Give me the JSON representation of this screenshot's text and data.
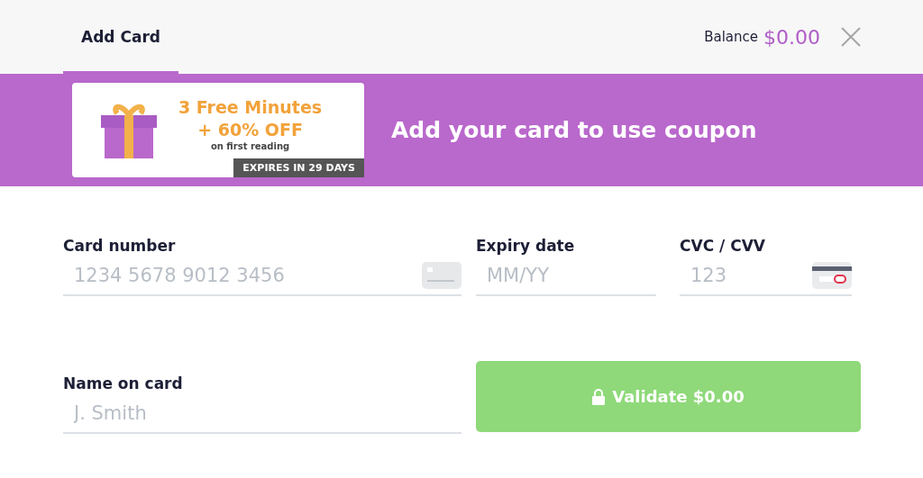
{
  "tabs": [
    {
      "label": "Add Card",
      "selected": true
    }
  ],
  "balance": {
    "label": "Balance",
    "amount": "$0.00"
  },
  "coupon": {
    "headline": "3 Free Minutes",
    "offer": "+ 60% OFF",
    "note": "on first reading",
    "expires": "EXPIRES IN 29 DAYS",
    "message": "Add your card to use coupon"
  },
  "fields": [
    {
      "label": "Card number",
      "placeholder": "1234 5678 9012 3456",
      "kind": "card"
    },
    {
      "label": "Expiry date",
      "placeholder": "MM/YY",
      "kind": "plain"
    },
    {
      "label": "CVC / CVV",
      "placeholder": "123",
      "kind": "cvc"
    },
    {
      "label": "Name on card",
      "placeholder": "J. Smith",
      "kind": "plain"
    }
  ],
  "submit": {
    "label": "Validate $0.00"
  }
}
